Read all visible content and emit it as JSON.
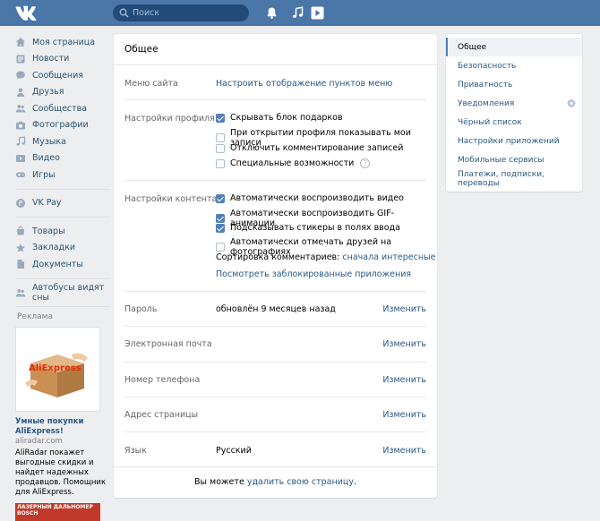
{
  "header": {
    "search_placeholder": "Поиск"
  },
  "leftnav": {
    "items": [
      {
        "label": "Моя страница"
      },
      {
        "label": "Новости"
      },
      {
        "label": "Сообщения"
      },
      {
        "label": "Друзья"
      },
      {
        "label": "Сообщества"
      },
      {
        "label": "Фотографии"
      },
      {
        "label": "Музыка"
      },
      {
        "label": "Видео"
      },
      {
        "label": "Игры"
      }
    ],
    "pay": "VK Pay",
    "items2": [
      {
        "label": "Товары"
      },
      {
        "label": "Закладки"
      },
      {
        "label": "Документы"
      }
    ],
    "extra": "Автобусы видят сны",
    "ads_label": "Реклама",
    "ad1": {
      "title": "Умные покупки AliExpress!",
      "domain": "aliradar.com",
      "text": "AliRadar покажет выгодные скидки и найдет надежных продавцов. Помощник для AliExpress.",
      "logo_text": "AliExpress"
    },
    "ad2": {
      "banner_text": "ЛАЗЕРНЫЙ ДАЛЬНОМЕР BOSCH"
    }
  },
  "main": {
    "title": "Общее",
    "menu": {
      "label": "Меню сайта",
      "link": "Настроить отображение пунктов меню"
    },
    "profile": {
      "label": "Настройки профиля",
      "options": [
        {
          "label": "Скрывать блок подарков",
          "checked": true
        },
        {
          "label": "При открытии профиля показывать мои записи",
          "checked": false
        },
        {
          "label": "Отключить комментирование записей",
          "checked": false
        },
        {
          "label": "Специальные возможности",
          "checked": false,
          "help": "?"
        }
      ]
    },
    "content": {
      "label": "Настройки контента",
      "options": [
        {
          "label": "Автоматически воспроизводить видео",
          "checked": true
        },
        {
          "label": "Автоматически воспроизводить GIF-анимации",
          "checked": true
        },
        {
          "label": "Подсказывать стикеры в полях ввода",
          "checked": true
        },
        {
          "label": "Автоматически отмечать друзей на фотографиях",
          "checked": false
        }
      ],
      "sort_label": "Сортировка комментариев:",
      "sort_value": "сначала интересные",
      "blocked_apps": "Посмотреть заблокированные приложения"
    },
    "rows": [
      {
        "label": "Пароль",
        "value": "обновлён 9 месяцев назад",
        "action": "Изменить"
      },
      {
        "label": "Электронная почта",
        "value": "",
        "action": "Изменить"
      },
      {
        "label": "Номер телефона",
        "value": "",
        "action": "Изменить"
      },
      {
        "label": "Адрес страницы",
        "value": "",
        "action": "Изменить"
      },
      {
        "label": "Язык",
        "value": "Русский",
        "action": "Изменить"
      }
    ],
    "footer": {
      "text": "Вы можете",
      "link": "удалить свою страницу",
      "end": "."
    }
  },
  "rightmenu": {
    "items": [
      {
        "label": "Общее",
        "active": true
      },
      {
        "label": "Безопасность"
      },
      {
        "label": "Приватность"
      },
      {
        "label": "Уведомления"
      },
      {
        "label": "Чёрный список"
      },
      {
        "label": "Настройки приложений"
      },
      {
        "label": "Мобильные сервисы"
      },
      {
        "label": "Платежи, подписки, переводы"
      }
    ]
  },
  "colors": {
    "header": "#4a76a8",
    "link": "#2a5885",
    "accent": "#5181b8",
    "background": "#edeef0"
  }
}
